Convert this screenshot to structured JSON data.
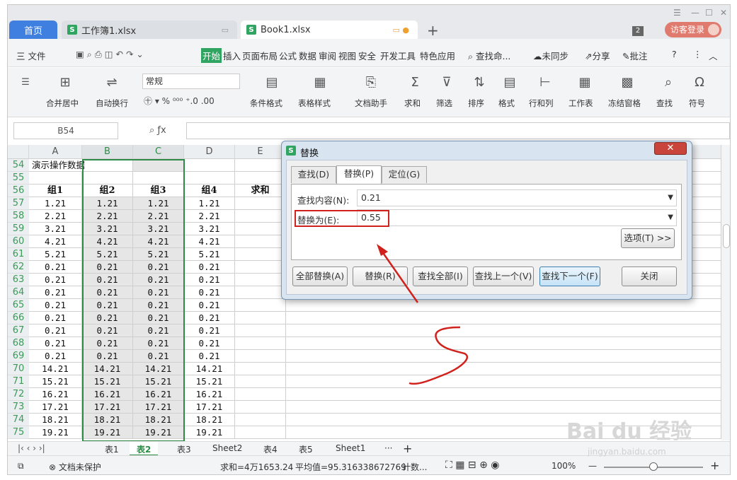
{
  "tabs": {
    "home": "首页",
    "book1": "工作簿1.xlsx",
    "book2": "Book1.xlsx",
    "count": "2",
    "visitor": "访客登录"
  },
  "menu": [
    "三 文件",
    "开始",
    "插入",
    "页面布局",
    "公式",
    "数据",
    "审阅",
    "视图",
    "安全",
    "开发工具",
    "特色应用",
    "查找命...",
    "未同步",
    "分享",
    "批注"
  ],
  "ribbon": {
    "merge": "合并居中",
    "wrap": "自动换行",
    "format": "常规",
    "cond": "条件格式",
    "tablestyle": "表格样式",
    "doc": "文档助手",
    "sum": "求和",
    "filter": "筛选",
    "sort": "排序",
    "fmt": "格式",
    "rowcol": "行和列",
    "sheet": "工作表",
    "freeze": "冻结窗格",
    "find": "查找",
    "symbol": "符号"
  },
  "cellref": "B54",
  "columns": [
    "A",
    "B",
    "C",
    "D",
    "E"
  ],
  "rows": [
    {
      "n": "54",
      "c": [
        "演示操作数据",
        "",
        "",
        "",
        ""
      ]
    },
    {
      "n": "55",
      "c": [
        "",
        "",
        "",
        "",
        ""
      ]
    },
    {
      "n": "56",
      "c": [
        "组1",
        "组2",
        "组3",
        "组4",
        "求和"
      ]
    },
    {
      "n": "57",
      "c": [
        "1.21",
        "1.21",
        "1.21",
        "1.21",
        ""
      ]
    },
    {
      "n": "58",
      "c": [
        "2.21",
        "2.21",
        "2.21",
        "2.21",
        ""
      ]
    },
    {
      "n": "59",
      "c": [
        "3.21",
        "3.21",
        "3.21",
        "3.21",
        ""
      ]
    },
    {
      "n": "60",
      "c": [
        "4.21",
        "4.21",
        "4.21",
        "4.21",
        ""
      ]
    },
    {
      "n": "61",
      "c": [
        "5.21",
        "5.21",
        "5.21",
        "5.21",
        ""
      ]
    },
    {
      "n": "62",
      "c": [
        "0.21",
        "0.21",
        "0.21",
        "0.21",
        ""
      ]
    },
    {
      "n": "63",
      "c": [
        "0.21",
        "0.21",
        "0.21",
        "0.21",
        ""
      ]
    },
    {
      "n": "64",
      "c": [
        "0.21",
        "0.21",
        "0.21",
        "0.21",
        ""
      ]
    },
    {
      "n": "65",
      "c": [
        "0.21",
        "0.21",
        "0.21",
        "0.21",
        ""
      ]
    },
    {
      "n": "66",
      "c": [
        "0.21",
        "0.21",
        "0.21",
        "0.21",
        ""
      ]
    },
    {
      "n": "67",
      "c": [
        "0.21",
        "0.21",
        "0.21",
        "0.21",
        ""
      ]
    },
    {
      "n": "68",
      "c": [
        "0.21",
        "0.21",
        "0.21",
        "0.21",
        ""
      ]
    },
    {
      "n": "69",
      "c": [
        "0.21",
        "0.21",
        "0.21",
        "0.21",
        ""
      ]
    },
    {
      "n": "70",
      "c": [
        "14.21",
        "14.21",
        "14.21",
        "14.21",
        ""
      ]
    },
    {
      "n": "71",
      "c": [
        "15.21",
        "15.21",
        "15.21",
        "15.21",
        ""
      ]
    },
    {
      "n": "72",
      "c": [
        "16.21",
        "16.21",
        "16.21",
        "16.21",
        ""
      ]
    },
    {
      "n": "73",
      "c": [
        "17.21",
        "17.21",
        "17.21",
        "17.21",
        ""
      ]
    },
    {
      "n": "74",
      "c": [
        "18.21",
        "18.21",
        "18.21",
        "18.21",
        ""
      ]
    },
    {
      "n": "75",
      "c": [
        "19.21",
        "19.21",
        "19.21",
        "19.21",
        ""
      ]
    }
  ],
  "sheets": [
    "表1",
    "表2",
    "表3",
    "Sheet2",
    "表4",
    "表5",
    "Sheet1"
  ],
  "status": {
    "protect": "文档未保护",
    "sum": "求和=4万1653.24",
    "avg": "平均值=95.316338672769",
    "count": "计数...",
    "zoom": "100%"
  },
  "dialog": {
    "title": "替换",
    "tab_find": "查找(D)",
    "tab_replace": "替换(P)",
    "tab_goto": "定位(G)",
    "find_label": "查找内容(N):",
    "find_value": "0.21",
    "replace_label": "替换为(E):",
    "replace_value": "0.55",
    "options": "选项(T) >>",
    "replace_all": "全部替换(A)",
    "replace": "替换(R)",
    "find_all": "查找全部(I)",
    "find_prev": "查找上一个(V)",
    "find_next": "查找下一个(F)",
    "close": "关闭"
  },
  "watermark": "Bai du 经验",
  "watermark_url": "jingyan.baidu.com"
}
